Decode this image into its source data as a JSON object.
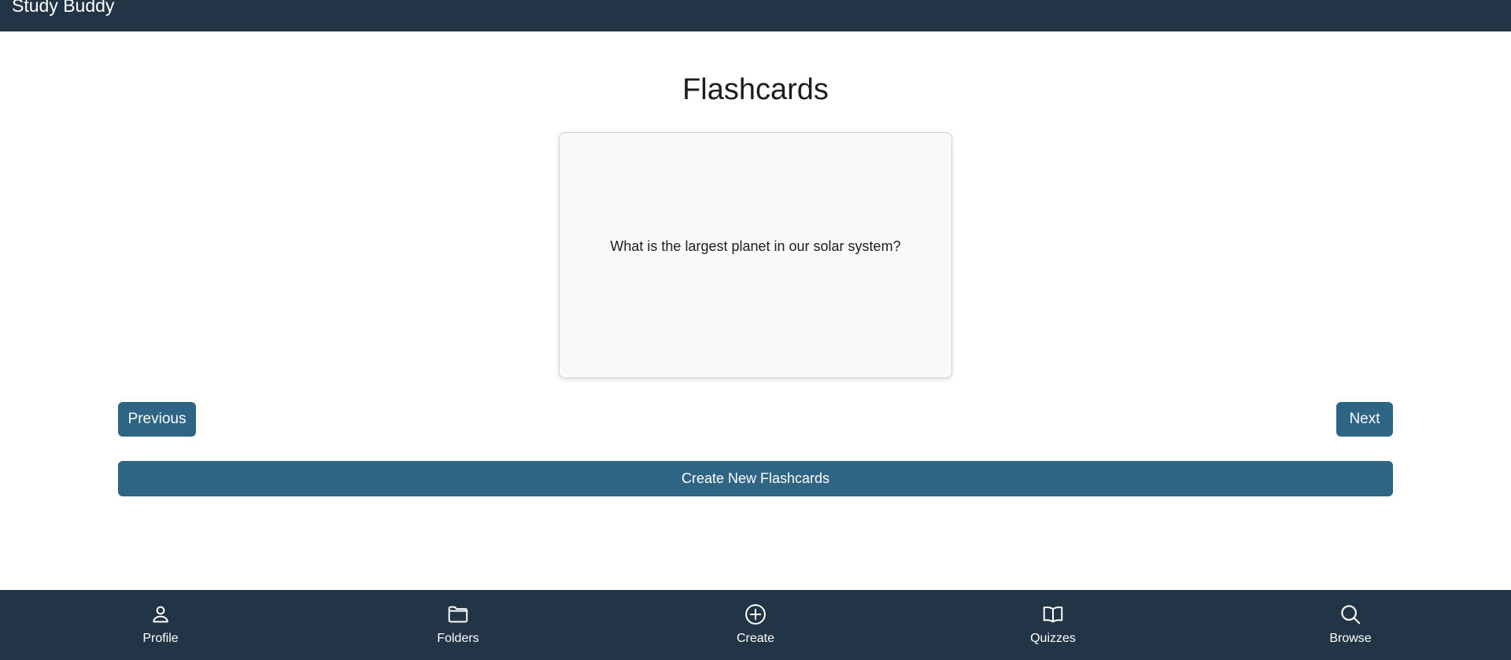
{
  "header": {
    "brand": "Study Buddy"
  },
  "main": {
    "title": "Flashcards",
    "card": {
      "question": "What is the largest planet in our solar system?"
    },
    "previous_label": "Previous",
    "next_label": "Next",
    "create_label": "Create New Flashcards"
  },
  "nav": {
    "items": [
      {
        "label": "Profile",
        "icon": "person-icon"
      },
      {
        "label": "Folders",
        "icon": "folder-icon"
      },
      {
        "label": "Create",
        "icon": "plus-circle-icon"
      },
      {
        "label": "Quizzes",
        "icon": "book-icon"
      },
      {
        "label": "Browse",
        "icon": "search-icon"
      }
    ]
  },
  "colors": {
    "navbar_bg": "#223547",
    "button_bg": "#2e6585",
    "card_bg": "#f8f9fa"
  }
}
